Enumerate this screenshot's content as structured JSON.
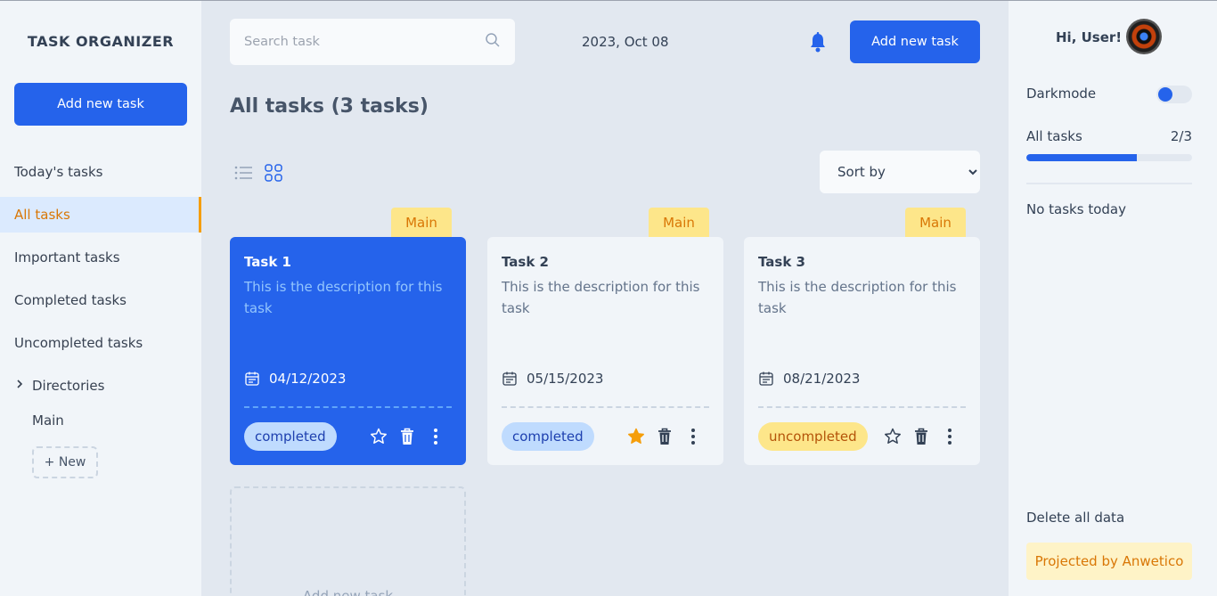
{
  "app": {
    "brand": "TASK ORGANIZER"
  },
  "sidebar": {
    "add_label": "Add new task",
    "items": [
      {
        "label": "Today's tasks"
      },
      {
        "label": "All tasks"
      },
      {
        "label": "Important tasks"
      },
      {
        "label": "Completed tasks"
      },
      {
        "label": "Uncompleted tasks"
      }
    ],
    "directories_label": "Directories",
    "directories": [
      {
        "label": "Main"
      }
    ],
    "new_dir_label": "+ New"
  },
  "header": {
    "search_placeholder": "Search task",
    "date": "2023, Oct 08",
    "add_label": "Add new task"
  },
  "main": {
    "title": "All tasks (3 tasks)",
    "sort_label": "Sort by",
    "add_card_label": "Add new task"
  },
  "tasks": [
    {
      "dir": "Main",
      "title": "Task 1",
      "description": "This is the description for this task",
      "date": "04/12/2023",
      "status": "completed",
      "important": false
    },
    {
      "dir": "Main",
      "title": "Task 2",
      "description": "This is the description for this task",
      "date": "05/15/2023",
      "status": "completed",
      "important": true
    },
    {
      "dir": "Main",
      "title": "Task 3",
      "description": "This is the description for this task",
      "date": "08/21/2023",
      "status": "uncompleted",
      "important": false
    }
  ],
  "right": {
    "greeting": "Hi, User!",
    "darkmode_label": "Darkmode",
    "progress_label": "All tasks",
    "progress_text": "2/3",
    "progress_fraction": 0.667,
    "no_tasks": "No tasks today",
    "delete_label": "Delete all data",
    "credit": "Projected by Anwetico"
  },
  "colors": {
    "primary": "#2563eb",
    "accent": "#f59e0b",
    "tag_bg": "#fde68a"
  }
}
